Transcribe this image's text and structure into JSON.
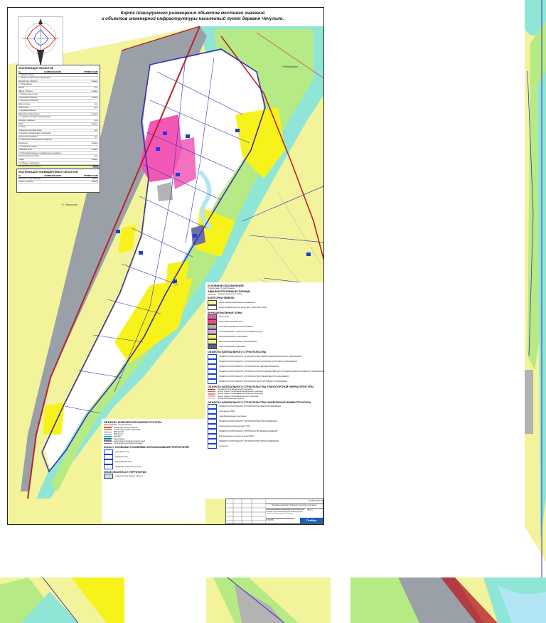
{
  "title": {
    "line1": "Карта планируемого размещения объектов местного значения",
    "line2": "и объектов инженерной инфраструктуры населенный пункт деревня Чечулино."
  },
  "map_labels": {
    "village": "д. Чечулино",
    "road_ne": "Подберезье"
  },
  "objects_table": {
    "title": "ЭКСПЛИКАЦИЯ ОБЪЕКТОВ",
    "col_no": "№",
    "col_name": "НАИМЕНОВАНИЕ",
    "col_note": "ПРИМЕЧАНИЕ",
    "rows": [
      {
        "name": "1. Администрация"
      },
      {
        "name": "2. Объекты социального назначения"
      },
      {
        "name": "Детский сад, 100 мест",
        "note": "планир."
      },
      {
        "name": "3. Образование"
      },
      {
        "name": "Школа",
        "note": "сущ."
      },
      {
        "name": "Школа, 275 мест",
        "note": "планир."
      },
      {
        "name": "4. Физкультура и спорт"
      },
      {
        "name": "Спортивный комплекс",
        "note": "планир."
      },
      {
        "name": "5. Культура и искусство"
      },
      {
        "name": "Дом культуры",
        "note": "сущ."
      },
      {
        "name": "Библиотека",
        "note": "сущ."
      },
      {
        "name": "6. Здравоохранение"
      },
      {
        "name": "Врачебная амбулатория",
        "note": "планир."
      },
      {
        "name": "7. Торговля и бытовое обслуживание"
      },
      {
        "name": "Магазин, павильон",
        "note": "сущ."
      },
      {
        "name": "Кафе",
        "note": "планир."
      },
      {
        "name": "8. Связь"
      },
      {
        "name": "Отделение почтовой связи",
        "note": "сущ."
      },
      {
        "name": "9. Кредитно-финансовые учреждения"
      },
      {
        "name": "Отделение сбербанка",
        "note": "сущ."
      },
      {
        "name": "10. Жилищно-коммунальное хозяйство"
      },
      {
        "name": "Котельная",
        "note": "планир."
      },
      {
        "name": "11. Пожарная охрана"
      },
      {
        "name": "Пожарное депо",
        "note": "планир."
      },
      {
        "name": "12. Производственные и коммунально-складские"
      },
      {
        "name": "Производственная база",
        "note": "сущ."
      },
      {
        "name": "Склад",
        "note": "планир."
      },
      {
        "name": "13. Объекты транспорта"
      },
      {
        "name": "Автозаправочная станция",
        "note": "планир."
      },
      {
        "name": "Остановочный павильон",
        "note": "планир."
      }
    ]
  },
  "removed_table": {
    "title": "ЭКСПЛИКАЦИЯ ЛИКВИДИРУЕМЫХ ОБЪЕКТОВ",
    "col_no": "№",
    "col_name": "НАИМЕНОВАНИЕ",
    "col_note": "ПРИМЕЧАНИЕ",
    "rows": [
      {
        "name": "Котельная существующая",
        "note": "ликвид."
      },
      {
        "name": "Объект торговли",
        "note": "ликвид."
      }
    ]
  },
  "legend": {
    "title": "УСЛОВНЫЕ ОБОЗНАЧЕНИЯ:",
    "subtitle": "Планируемые / Существующие",
    "admin_title": "АДМИНИСТРАТИВНЫЕ ГРАНИЦЫ",
    "admin_items": [
      "граница населенного пункта"
    ],
    "land_title": "КАТЕГОРИИ ЗЕМЕЛЬ",
    "land_items": [
      "земли сельскохозяйственного назначения",
      "земли промышленности, энергетики, транспорта, связи"
    ],
    "zones_title": "ФУНКЦИОНАЛЬНЫЕ ЗОНЫ",
    "zones": [
      {
        "color": "#f45aa8",
        "label": "жилая зона"
      },
      {
        "color": "#ee4d7c",
        "label": "общественно-деловая зона"
      },
      {
        "color": "#b3b3b3",
        "label": "зона производственного использования"
      },
      {
        "color": "#d9a6ef",
        "label": "зона инженерной и транспортной инфраструктуры"
      },
      {
        "color": "#f3f06a",
        "label": "зона рекреационного назначения"
      },
      {
        "color": "#e9f78e",
        "label": "зона сельскохозяйственного использования"
      },
      {
        "color": "#5c5c8f",
        "label": "зона специального назначения"
      }
    ],
    "capital_title": "ОБЪЕКТЫ КАПИТАЛЬНОГО СТРОИТЕЛЬСТВА",
    "capital_items": [
      "ОБЪЕКТЫ КАПИТАЛЬНОГО СТРОИТЕЛЬСТВА УЧЕБНО-ОБРАЗОВАТЕЛЬНОГО НАЗНАЧЕНИЯ",
      "ОБЪЕКТЫ КАПИТАЛЬНОГО СТРОИТЕЛЬСТВА КУЛЬТУРНО-ДОСУГОВОГО НАЗНАЧЕНИЯ",
      "ОБЪЕКТЫ КАПИТАЛЬНОГО СТРОИТЕЛЬСТВА ЗДРАВООХРАНЕНИЯ",
      "ОБЪЕКТЫ КАПИТАЛЬНОГО СТРОИТЕЛЬСТВА ПРОИЗВОДСТВЕННОГО И КОММУНАЛЬНО-СКЛАДСКОГО НАЗНАЧЕНИЯ",
      "ОБЪЕКТЫ КАПИТАЛЬНОГО СТРОИТЕЛЬСТВА СПЕЦИАЛЬНОГО НАЗНАЧЕНИЯ",
      "ОБЪЕКТЫ КАПИТАЛЬНОГО СТРОИТЕЛЬСТВА СПОРТИВНОГО НАЗНАЧЕНИЯ"
    ],
    "transport_title": "ОБЪЕКТЫ КАПИТАЛЬНОГО СТРОИТЕЛЬСТВА ТРАНСПОРТНОЙ ИНФРАСТРУКТУРЫ",
    "transport_items": [
      {
        "color": "#b8222b",
        "label": "автомагистрали федерального значения"
      },
      {
        "color": "#c76b5a",
        "label": "дороги общего пользования федерального значения"
      },
      {
        "color": "#d99a8c",
        "label": "дороги общего пользования регионального значения"
      },
      {
        "color": "#e6b6aa",
        "label": "дороги общего пользования местного значения"
      },
      {
        "color": "#efd3cc",
        "label": "прочие автомобильные дороги"
      }
    ],
    "engineering_title": "ОБЪЕКТЫ КАПИТАЛЬНОГО СТРОИТЕЛЬСТВА ИНЖЕНЕРНОЙ ИНФРАСТРУКТУРЫ",
    "engineering_items": [
      "ОБЪЕКТЫ КАПИТАЛЬНОГО СТРОИТЕЛЬСТВА ЭЛЕКТРОСНАБЖЕНИЯ",
      "подстанция 110кВ",
      "трансформаторные подстанции",
      "ОБЪЕКТЫ КАПИТАЛЬНОГО СТРОИТЕЛЬСТВА ГАЗОСНАБЖЕНИЯ",
      "газораспределительный пункт (ГРП)",
      "ОБЪЕКТЫ КАПИТАЛЬНОГО СТРОИТЕЛЬСТВА ВОДОСНАБЖЕНИЯ",
      "водопроводные очистные станции (ВОС)",
      "ОБЪЕКТЫ КАПИТАЛЬНОГО СТРОИТЕЛЬСТВА ТЕПЛОСНАБЖЕНИЯ",
      "котельная"
    ]
  },
  "infra_legend": {
    "title": "ОБЪЕКТЫ ИНЖЕНЕРНОЙ ИНФРАСТРУКТУРЫ",
    "subtitle": "Проектируемые / Существующие",
    "items": [
      {
        "color": "#e04d4d",
        "label": "газопровод магистральный"
      },
      {
        "color": "#e59b3a",
        "label": "газопровод среднего давления"
      },
      {
        "color": "#4a6fd6",
        "label": "ВЛЭ 110 кВ"
      },
      {
        "color": "#6b8be3",
        "label": "ВЛЭ 10 кВ"
      },
      {
        "color": "#3aa1d6",
        "label": "водовод"
      },
      {
        "color": "#2a7c3a",
        "label": "канализация"
      },
      {
        "color": "#777777",
        "label": "канализация напорная (самотечная)"
      },
      {
        "color": "#a05cd6",
        "label": "теплопровод распределительный"
      }
    ],
    "zones_title": "ЗОНЫ С ОСОБЫМИ УСЛОВИЯМИ ИСПОЛЬЗОВАНИЯ ТЕРРИТОРИЙ",
    "zones_items": [
      "санитарная зона",
      "охранная зона",
      "водоохранная зона",
      "прибрежная защитная полоса"
    ],
    "other_title": "ИНЫЕ ОБЪЕКТЫ И ТЕРРИТОРИИ",
    "other_items": [
      "поверхностные водные объекты"
    ]
  },
  "stamp": {
    "code": "№ 28.01-11-ГП-Ч",
    "project": "Генеральный план Губинского сельского поселения",
    "sheet_title": "Карта планируемого размещения объектов местного значения и объектов инженерной инфраструктуры населенный пункт деревня Чечулино",
    "scale": "М 1:5000",
    "company": "ГеоМир",
    "stage": "ГП",
    "sheet": "1",
    "sheets": "1"
  },
  "colors": {
    "agri": "#f3f39b",
    "yellow_zone": "#f7f21a",
    "green_buffer": "#b6ea85",
    "cyan_buffer": "#8fe6d6",
    "pink_zone": "#f257b5",
    "grey_zone": "#9aa0a8",
    "boundary": "#3b2fb3",
    "road": "#b8222b",
    "river": "#b3e6f5"
  }
}
